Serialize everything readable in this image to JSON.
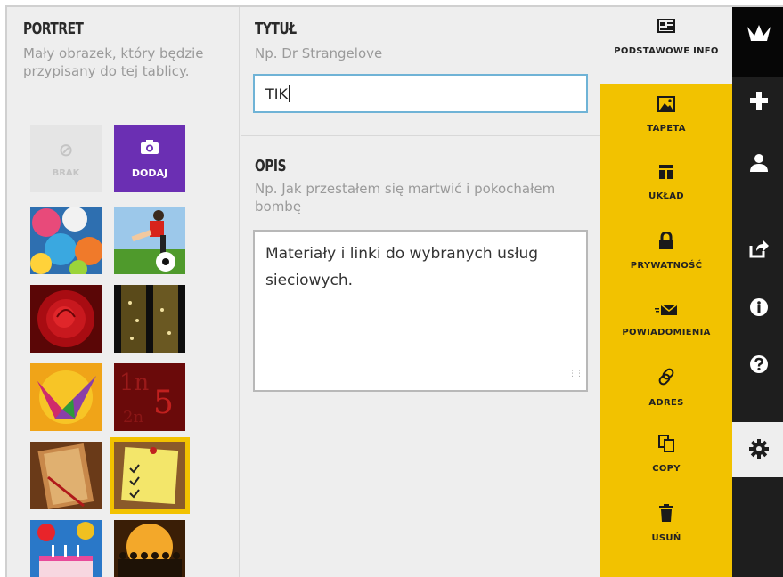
{
  "portrait": {
    "title": "PORTRET",
    "hint": "Mały obrazek, który będzie przypisany do tej tablicy.",
    "none_label": "BRAK",
    "add_label": "DODAJ",
    "images": [
      {
        "name": "colorful-balloons"
      },
      {
        "name": "soccer-player"
      },
      {
        "name": "red-rose"
      },
      {
        "name": "champagne-bubbles"
      },
      {
        "name": "paper-crane"
      },
      {
        "name": "red-numbers"
      },
      {
        "name": "notebook-pencil"
      },
      {
        "name": "sticky-note-checklist",
        "selected": true
      },
      {
        "name": "birthday-cake"
      },
      {
        "name": "paper-people"
      }
    ]
  },
  "title_section": {
    "title": "TYTUŁ",
    "placeholder": "Np. Dr Strangelove",
    "value": "TIK"
  },
  "desc_section": {
    "title": "OPIS",
    "placeholder": "Np. Jak przestałem się martwić i pokochałem bombę",
    "value": "Materiały i linki do wybranych usług sieciowych."
  },
  "menu": [
    {
      "label": "PODSTAWOWE INFO",
      "icon": "info-card-icon"
    },
    {
      "label": "TAPETA",
      "icon": "image-icon"
    },
    {
      "label": "UKŁAD",
      "icon": "layout-icon"
    },
    {
      "label": "PRYWATNOŚĆ",
      "icon": "lock-icon"
    },
    {
      "label": "POWIADOMIENIA",
      "icon": "envelope-icon"
    },
    {
      "label": "ADRES",
      "icon": "link-icon"
    },
    {
      "label": "COPY",
      "icon": "copy-icon"
    },
    {
      "label": "USUŃ",
      "icon": "trash-icon"
    }
  ],
  "sidebar": [
    {
      "icon": "padlet-logo-icon"
    },
    {
      "icon": "plus-icon"
    },
    {
      "icon": "user-icon"
    },
    {
      "icon": "share-icon"
    },
    {
      "icon": "info-icon"
    },
    {
      "icon": "help-icon"
    },
    {
      "icon": "gear-icon",
      "active": true
    }
  ],
  "colors": {
    "accent_yellow": "#f2c200",
    "add_purple": "#6b2fb3",
    "input_focus": "#6fb3d6",
    "sidebar_dark": "#1e1e1e"
  }
}
